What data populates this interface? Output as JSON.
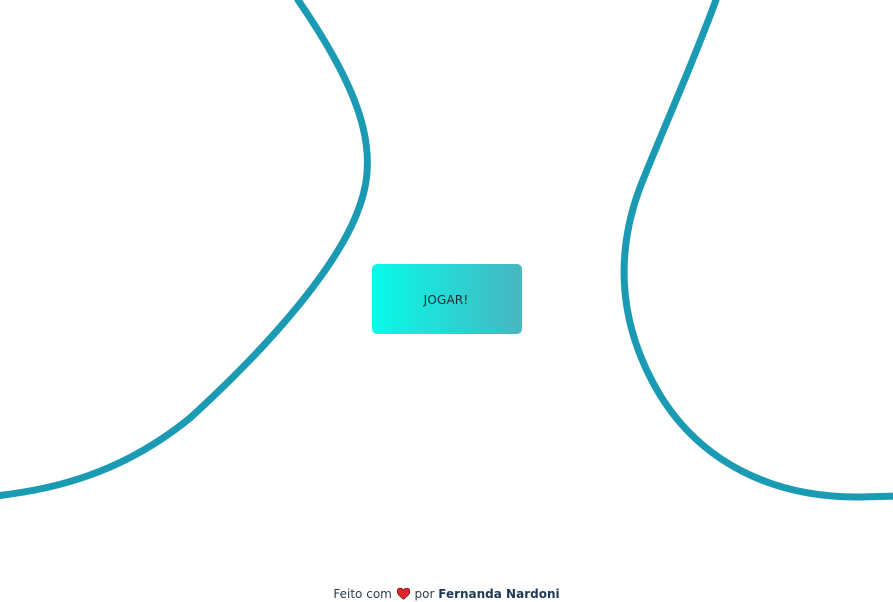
{
  "play_button": {
    "label": "JOGAR!"
  },
  "footer": {
    "prefix": "Feito com",
    "middle": "por",
    "author": "Fernanda Nardoni",
    "heart_icon": "heart-icon"
  },
  "colors": {
    "curve": "#1a9bb3",
    "button_gradient_start": "#07fbe9",
    "button_gradient_end": "#47b5c1",
    "heart": "#e3242b",
    "footer_text": "#2d3e4b",
    "author_text": "#1f3a54"
  }
}
